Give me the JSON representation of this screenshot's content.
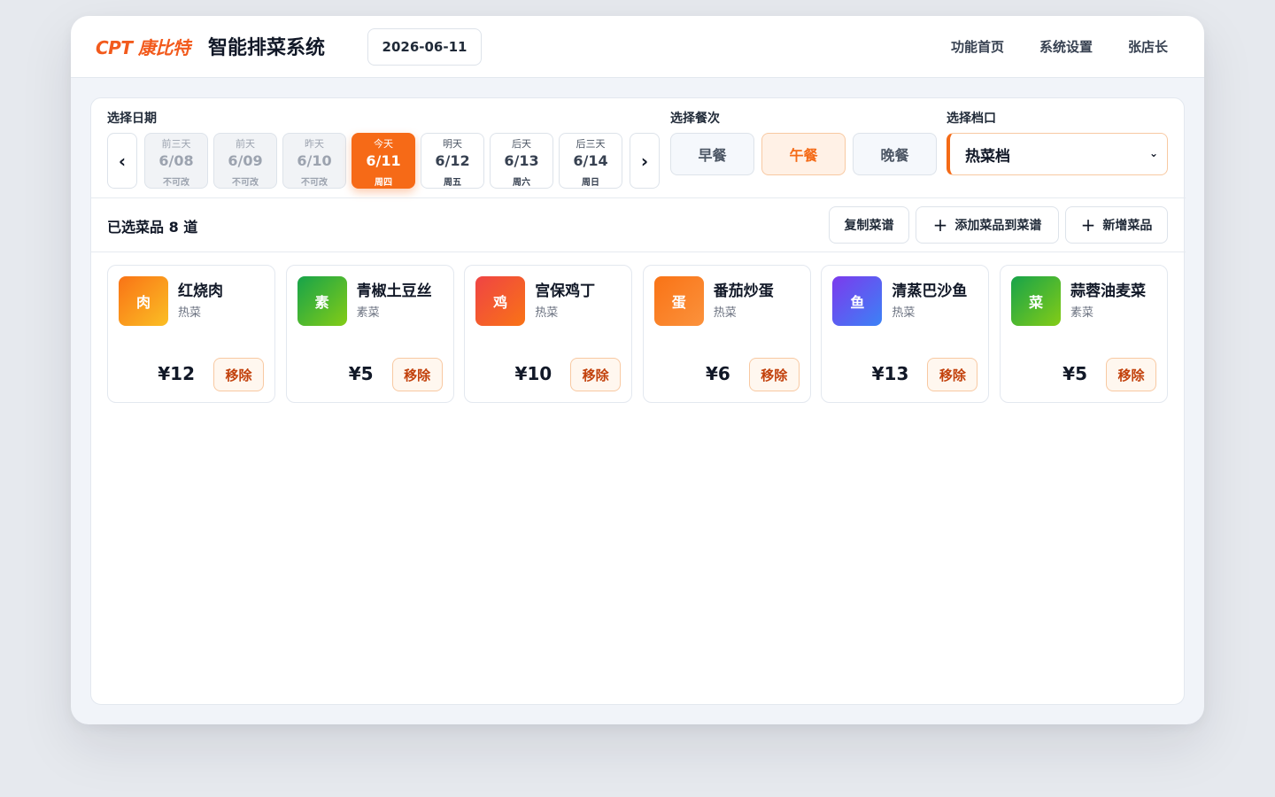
{
  "header": {
    "brand": "CPT 康比特",
    "title": "智能排菜系统",
    "date": "2026-06-11",
    "nav": {
      "home": "功能首页",
      "settings": "系统设置",
      "user": "张店长"
    }
  },
  "filters": {
    "date_label": "选择日期",
    "prev_arrow": "‹",
    "next_arrow": "›",
    "days": [
      {
        "rel": "前三天",
        "md": "6/08",
        "sub": "不可改",
        "state": "locked"
      },
      {
        "rel": "前天",
        "md": "6/09",
        "sub": "不可改",
        "state": "locked"
      },
      {
        "rel": "昨天",
        "md": "6/10",
        "sub": "不可改",
        "state": "locked"
      },
      {
        "rel": "今天",
        "md": "6/11",
        "sub": "周四",
        "state": "active"
      },
      {
        "rel": "明天",
        "md": "6/12",
        "sub": "周五",
        "state": "normal"
      },
      {
        "rel": "后天",
        "md": "6/13",
        "sub": "周六",
        "state": "normal"
      },
      {
        "rel": "后三天",
        "md": "6/14",
        "sub": "周日",
        "state": "normal"
      }
    ],
    "meal_label": "选择餐次",
    "meals": [
      {
        "label": "早餐",
        "active": false
      },
      {
        "label": "午餐",
        "active": true
      },
      {
        "label": "晚餐",
        "active": false
      }
    ],
    "stall_label": "选择档口",
    "stall_value": "热菜档",
    "stall_chevron": "⌄"
  },
  "toolbar": {
    "selected_count": "已选菜品 8 道",
    "copy_label": "复制菜谱",
    "add_label": "添加菜品到菜谱",
    "new_label": "新增菜品",
    "plus_glyph": "+"
  },
  "dishes": [
    {
      "badge": "肉",
      "name": "红烧肉",
      "category": "热菜",
      "price": "¥12",
      "remove": "移除",
      "colors": [
        "#f97316",
        "#fbbf24"
      ]
    },
    {
      "badge": "素",
      "name": "青椒土豆丝",
      "category": "素菜",
      "price": "¥5",
      "remove": "移除",
      "colors": [
        "#16a34a",
        "#84cc16"
      ]
    },
    {
      "badge": "鸡",
      "name": "宫保鸡丁",
      "category": "热菜",
      "price": "¥10",
      "remove": "移除",
      "colors": [
        "#ef4444",
        "#f97316"
      ]
    },
    {
      "badge": "蛋",
      "name": "番茄炒蛋",
      "category": "热菜",
      "price": "¥6",
      "remove": "移除",
      "colors": [
        "#f97316",
        "#fb923c"
      ]
    },
    {
      "badge": "鱼",
      "name": "清蒸巴沙鱼",
      "category": "热菜",
      "price": "¥13",
      "remove": "移除",
      "colors": [
        "#7c3aed",
        "#3b82f6"
      ]
    },
    {
      "badge": "菜",
      "name": "蒜蓉油麦菜",
      "category": "素菜",
      "price": "¥5",
      "remove": "移除",
      "colors": [
        "#16a34a",
        "#84cc16"
      ]
    }
  ],
  "colors": {
    "accent": "#f66a17",
    "accent_soft": "#fff1e6"
  }
}
